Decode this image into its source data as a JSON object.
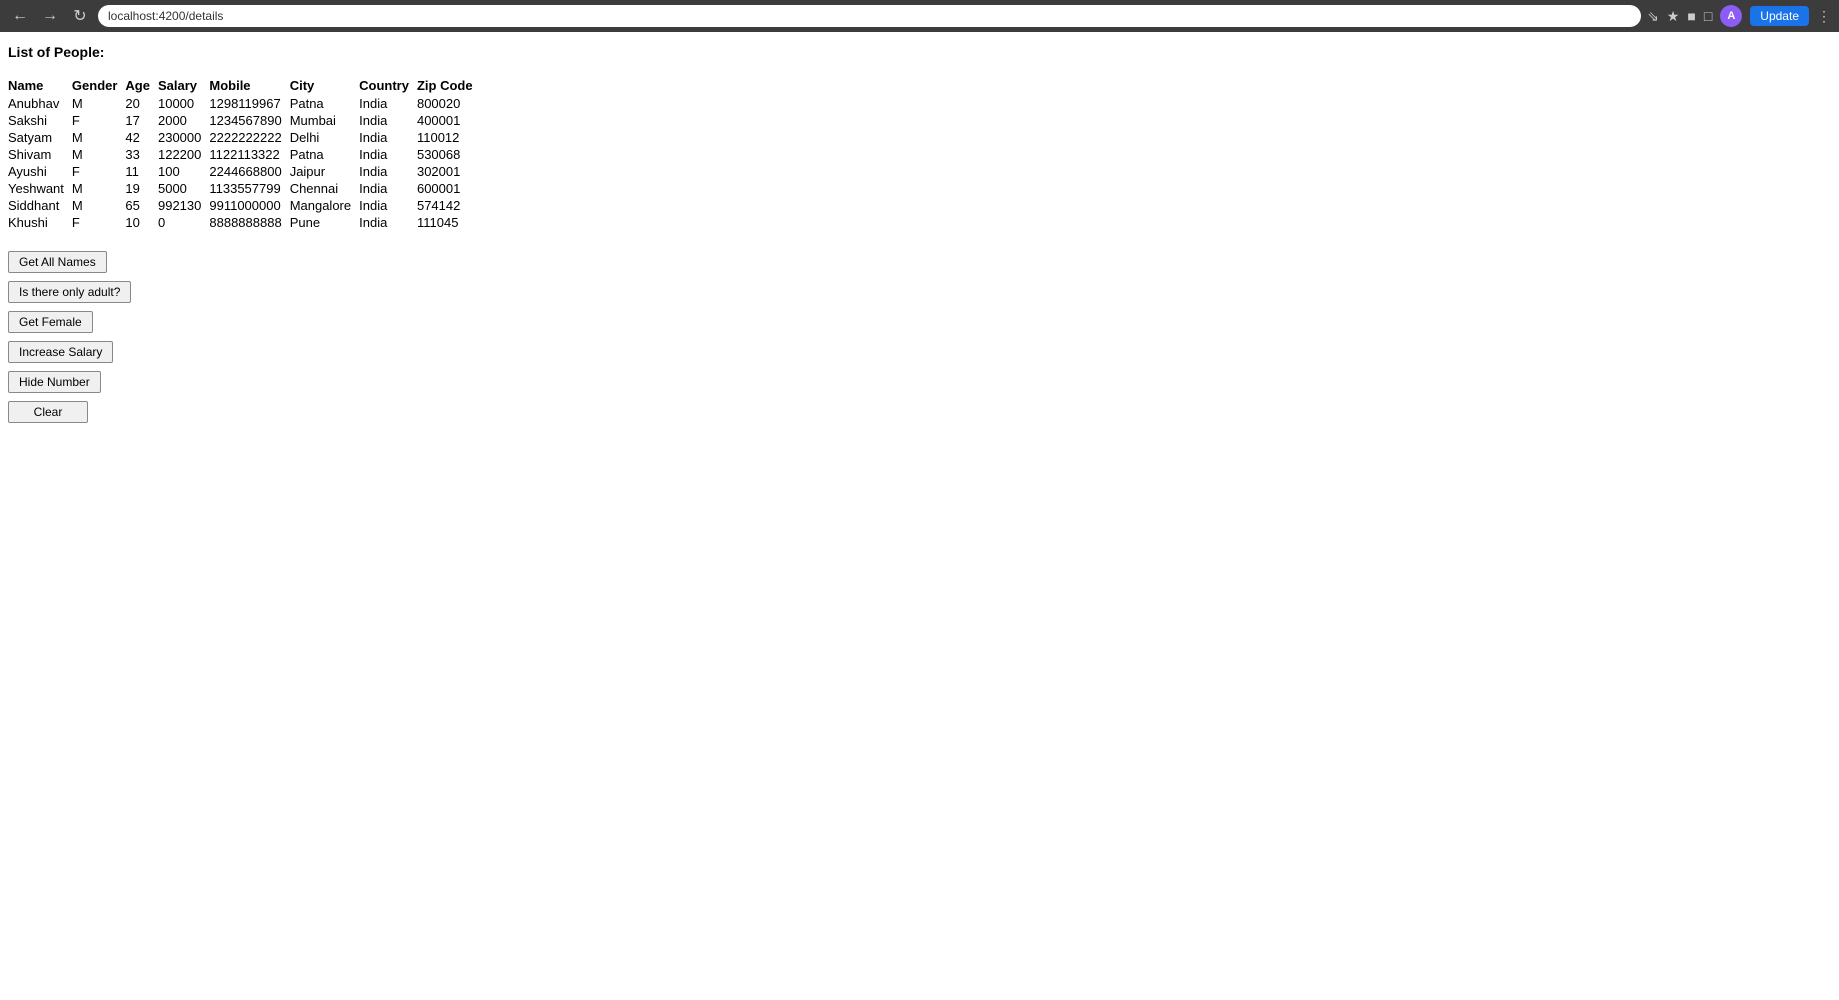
{
  "browser": {
    "url": "localhost:4200/details",
    "update_label": "Update",
    "avatar_label": "A"
  },
  "page": {
    "title": "List of People:"
  },
  "table": {
    "headers": [
      "Name",
      "Gender",
      "Age",
      "Salary",
      "Mobile",
      "City",
      "Country",
      "Zip Code"
    ],
    "rows": [
      [
        "Anubhav",
        "M",
        "20",
        "10000",
        "1298119967",
        "Patna",
        "India",
        "800020"
      ],
      [
        "Sakshi",
        "F",
        "17",
        "2000",
        "1234567890",
        "Mumbai",
        "India",
        "400001"
      ],
      [
        "Satyam",
        "M",
        "42",
        "230000",
        "2222222222",
        "Delhi",
        "India",
        "110012"
      ],
      [
        "Shivam",
        "M",
        "33",
        "122200",
        "1122113322",
        "Patna",
        "India",
        "530068"
      ],
      [
        "Ayushi",
        "F",
        "11",
        "100",
        "2244668800",
        "Jaipur",
        "India",
        "302001"
      ],
      [
        "Yeshwant",
        "M",
        "19",
        "5000",
        "1133557799",
        "Chennai",
        "India",
        "600001"
      ],
      [
        "Siddhant",
        "M",
        "65",
        "992130",
        "9911000000",
        "Mangalore",
        "India",
        "574142"
      ],
      [
        "Khushi",
        "F",
        "10",
        "0",
        "8888888888",
        "Pune",
        "India",
        "111045"
      ]
    ]
  },
  "buttons": {
    "get_all_names": "Get All Names",
    "is_adult": "Is there only adult?",
    "get_female": "Get Female",
    "increase_salary": "Increase Salary",
    "hide_number": "Hide Number",
    "clear": "Clear"
  }
}
